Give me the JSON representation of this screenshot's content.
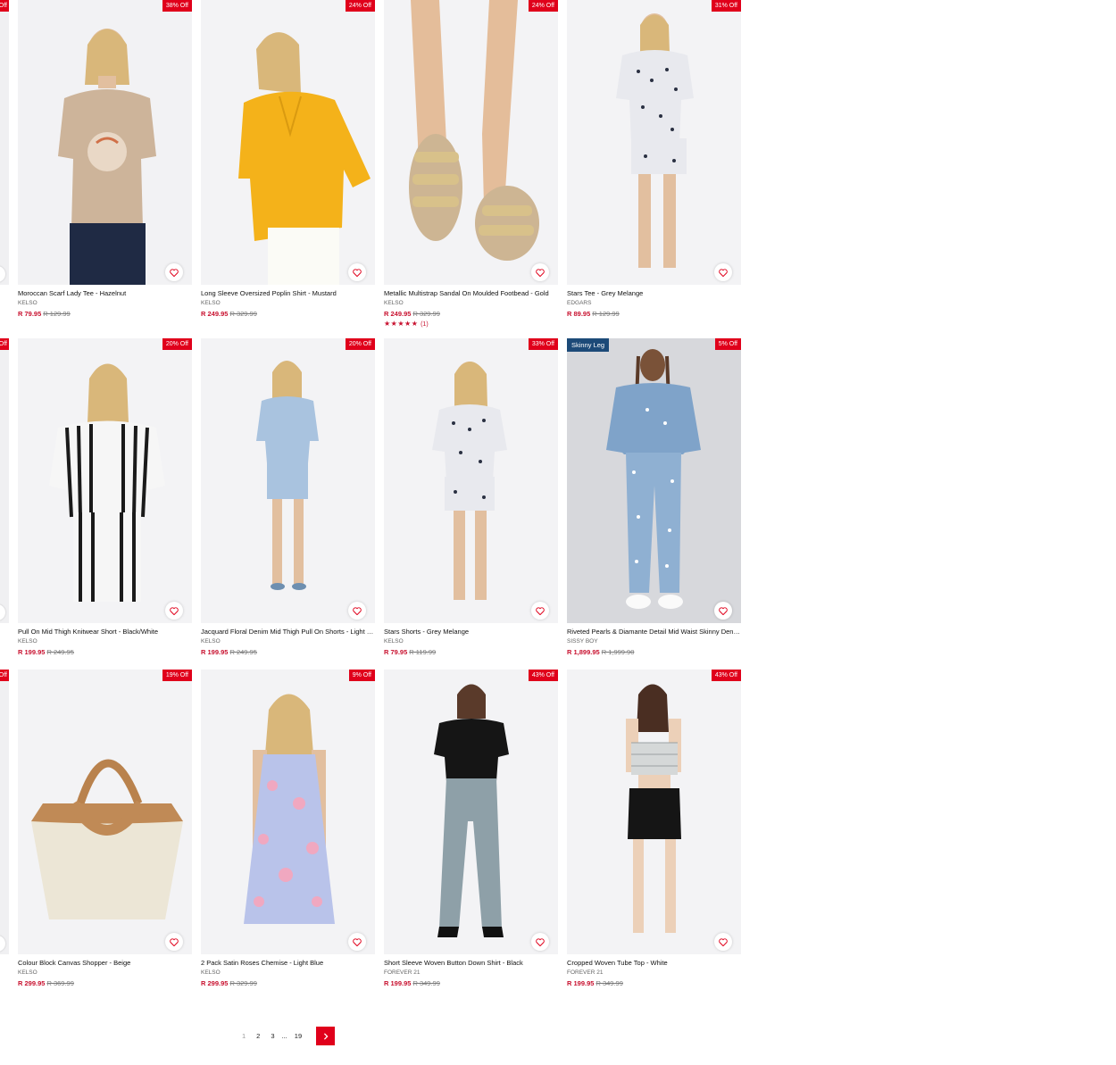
{
  "products": [
    {
      "title": "Moroccan Scarf Lady Tee - Hazelnut",
      "brand": "KELSO",
      "price": "R 79.95",
      "was": "R 129.99",
      "discount": "38% Off",
      "image": "tshirt-hazelnut"
    },
    {
      "title": "Long Sleeve Oversized Poplin Shirt - Mustard",
      "brand": "KELSO",
      "price": "R 249.95",
      "was": "R 329.99",
      "discount": "24% Off",
      "image": "shirt-mustard"
    },
    {
      "title": "Metallic Multistrap Sandal On Moulded Footbead - Gold",
      "brand": "KELSO",
      "price": "R 249.95",
      "was": "R 329.99",
      "discount": "24% Off",
      "image": "sandal-gold",
      "stars": "★★★★★",
      "reviews": "(1)"
    },
    {
      "title": "Stars Tee - Grey Melange",
      "brand": "EDGARS",
      "price": "R 89.95",
      "was": "R 129.99",
      "discount": "31% Off",
      "image": "stars-tee"
    },
    {
      "title": "Pull On Mid Thigh Knitwear Short - Black/White",
      "brand": "KELSO",
      "price": "R 199.95",
      "was": "R 249.95",
      "discount": "20% Off",
      "image": "knit-short"
    },
    {
      "title": "Jacquard Floral Denim Mid Thigh Pull On Shorts - Light Wash",
      "brand": "KELSO",
      "price": "R 199.95",
      "was": "R 249.95",
      "discount": "20% Off",
      "image": "denim-shorts"
    },
    {
      "title": "Stars Shorts - Grey Melange",
      "brand": "KELSO",
      "price": "R 79.95",
      "was": "R 119.99",
      "discount": "33% Off",
      "image": "stars-shorts"
    },
    {
      "title": "Riveted Pearls & Diamante Detail Mid Waist Skinny Denim Jeans",
      "brand": "SISSY BOY",
      "price": "R 1,899.95",
      "was": "R 1,999.90",
      "discount": "5% Off",
      "tag": "Skinny Leg",
      "image": "pearl-jeans"
    },
    {
      "title": "Colour Block Canvas Shopper - Beige",
      "brand": "KELSO",
      "price": "R 299.95",
      "was": "R 369.99",
      "discount": "19% Off",
      "image": "canvas-bag"
    },
    {
      "title": "2 Pack Satin Roses Chemise - Light Blue",
      "brand": "KELSO",
      "price": "R 299.95",
      "was": "R 329.99",
      "discount": "9% Off",
      "image": "chemise"
    },
    {
      "title": "Short Sleeve Woven Button Down Shirt - Black",
      "brand": "FOREVER 21",
      "price": "R 199.95",
      "was": "R 349.99",
      "discount": "43% Off",
      "image": "black-shirt"
    },
    {
      "title": "Cropped Woven Tube Top - White",
      "brand": "FOREVER 21",
      "price": "R 199.95",
      "was": "R 349.99",
      "discount": "43% Off",
      "image": "tube-top"
    }
  ],
  "edge_badges": [
    "Off",
    "Off",
    "Off"
  ],
  "pagination": {
    "pages": [
      "1",
      "2",
      "3",
      "...",
      "19"
    ],
    "current": "1",
    "next_icon": "chevron-right-icon"
  },
  "colors": {
    "sale": "#e0001b",
    "price": "#c8102e",
    "tag": "#1c4a78"
  }
}
